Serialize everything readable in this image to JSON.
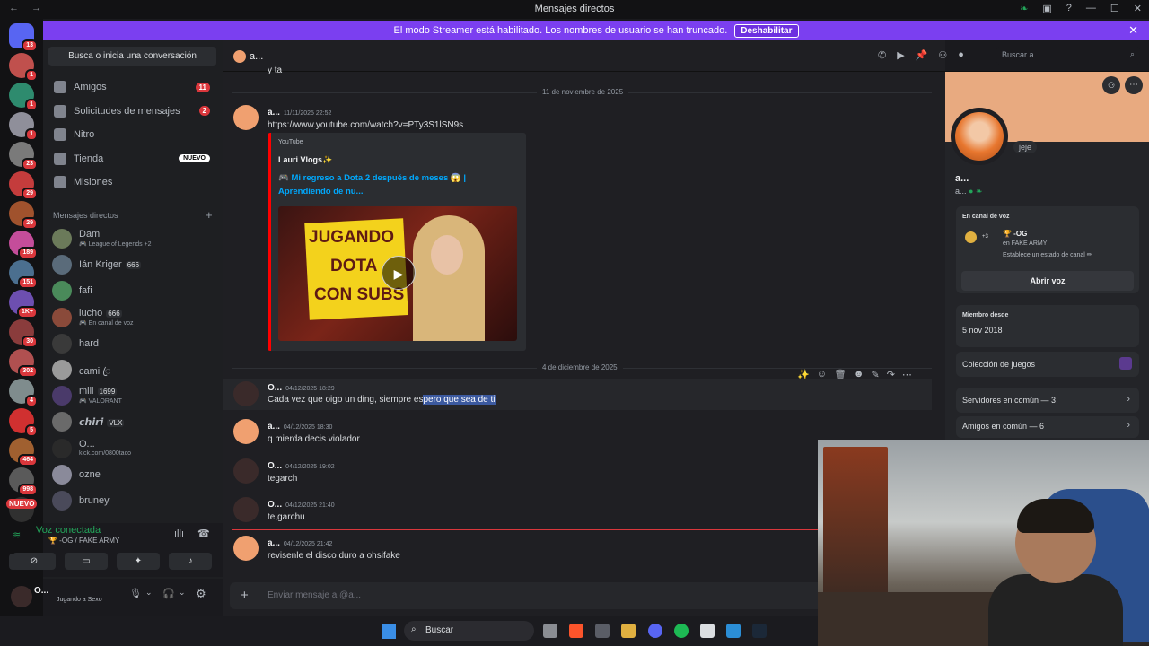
{
  "window": {
    "title": "Mensajes directos"
  },
  "banner": {
    "text": "El modo Streamer está habilitado. Los nombres de usuario se han truncado.",
    "button": "Deshabilitar"
  },
  "servers": [
    {
      "badge": "13",
      "color": "#5865f2"
    },
    {
      "badge": "1",
      "color": "#c0504d"
    },
    {
      "badge": "1",
      "color": "#2e8b6e"
    },
    {
      "badge": "1",
      "color": "#8f8f9a"
    },
    {
      "badge": "23",
      "color": "#7a7a7a"
    },
    {
      "badge": "29",
      "color": "#c43c3c"
    },
    {
      "badge": "29",
      "color": "#a0522d"
    },
    {
      "badge": "189",
      "color": "#c44d9a"
    },
    {
      "badge": "151",
      "color": "#4b6f8f"
    },
    {
      "badge": "1K+",
      "color": "#6d4fb0"
    },
    {
      "badge": "30",
      "color": "#8a3c3c"
    },
    {
      "badge": "302",
      "color": "#b05050"
    },
    {
      "badge": "4",
      "color": "#7f8c8d"
    },
    {
      "badge": "5",
      "color": "#d03030"
    },
    {
      "badge": "464",
      "color": "#a06030"
    },
    {
      "badge": "998",
      "color": "#5a5a5a"
    },
    {
      "badge": "",
      "color": "#303030"
    }
  ],
  "servers_new": "NUEVO",
  "sidebar": {
    "search": "Busca o inicia una conversación",
    "nav": [
      {
        "label": "Amigos",
        "count": "11"
      },
      {
        "label": "Solicitudes de mensajes",
        "count": "2"
      },
      {
        "label": "Nitro",
        "count": ""
      },
      {
        "label": "Tienda",
        "count": "",
        "tag": "NUEVO"
      },
      {
        "label": "Misiones",
        "count": ""
      }
    ],
    "dm_header": "Mensajes directos",
    "dms": [
      {
        "name": "Dam",
        "sub": "🎮 League of Legends +2",
        "tag": ""
      },
      {
        "name": "Ián Kriger",
        "sub": "",
        "tag": "666"
      },
      {
        "name": "fafi",
        "sub": "",
        "tag": ""
      },
      {
        "name": "lucho",
        "sub": "🎮 En canal de voz",
        "tag": "666"
      },
      {
        "name": "hard",
        "sub": "",
        "tag": ""
      },
      {
        "name": "cami ꦿ",
        "sub": "",
        "tag": ""
      },
      {
        "name": "mili",
        "sub": "🎮 VALORANT",
        "tag": "1699"
      },
      {
        "name": "𝙘𝙝𝙞𝙧𝙞",
        "sub": "",
        "tag": "VLX"
      },
      {
        "name": "O...",
        "sub": "kick.com/0800taco",
        "tag": ""
      },
      {
        "name": "ozne",
        "sub": "",
        "tag": ""
      },
      {
        "name": "bruney",
        "sub": "",
        "tag": ""
      }
    ],
    "voice": {
      "title": "Voz conectada",
      "sub": "🏆 -OG / FAKE ARMY"
    },
    "user": {
      "name": "O...",
      "status": "Jugando a Sexo"
    }
  },
  "chat": {
    "header_name": "a...",
    "search_placeholder": "Buscar a...",
    "prev_text": "y ta",
    "date1": "11 de noviembre de 2025",
    "date2": "4 de diciembre de 2025",
    "messages": [
      {
        "author": "a...",
        "time": "11/11/2025 22:52",
        "text": "https://www.youtube.com/watch?v=PTy3S1lSN9s",
        "avatar": "#f0a070"
      },
      {
        "author": "O...",
        "time": "04/12/2025 18:29",
        "text_a": "Cada vez que oigo un ding, siempre es",
        "text_b": "pero que sea de ti",
        "avatar": "#3a2a2a"
      },
      {
        "author": "a...",
        "time": "04/12/2025 18:30",
        "text": "q mierda decis violador",
        "avatar": "#f0a070"
      },
      {
        "author": "O...",
        "time": "04/12/2025 19:02",
        "text": "tegarch",
        "avatar": "#3a2a2a"
      },
      {
        "author": "O...",
        "time": "04/12/2025 21:40",
        "text": "te,garchu",
        "avatar": "#3a2a2a"
      },
      {
        "author": "a...",
        "time": "04/12/2025 21:42",
        "text": "revisenle el disco duro a ohsifake",
        "avatar": "#f0a070"
      }
    ],
    "embed": {
      "provider": "YouTube",
      "author": "Lauri Vlogs✨",
      "title": "🎮 Mi regreso a Dota 2 después de meses 😱 | Aprendiendo de nu...",
      "thumb_line1": "JUGANDO",
      "thumb_line2": "DOTA",
      "thumb_line3": "CON SUBS"
    },
    "compose_placeholder": "Enviar mensaje a @a..."
  },
  "profile": {
    "status": "jeje",
    "name": "a...",
    "tag": "a...",
    "voice_header": "En canal de voz",
    "voice_name": "🏆 -OG",
    "voice_server": "en FAKE ARMY",
    "voice_count": "+3",
    "voice_hint": "Establece un estado de canal ✏",
    "voice_button": "Abrir voz",
    "member_header": "Miembro desde",
    "member_since": "5 nov 2018",
    "games": "Colección de juegos",
    "servers_common": "Servidores en común — 3",
    "friends_common": "Amigos en común — 6"
  },
  "taskbar": {
    "search": "Buscar"
  }
}
